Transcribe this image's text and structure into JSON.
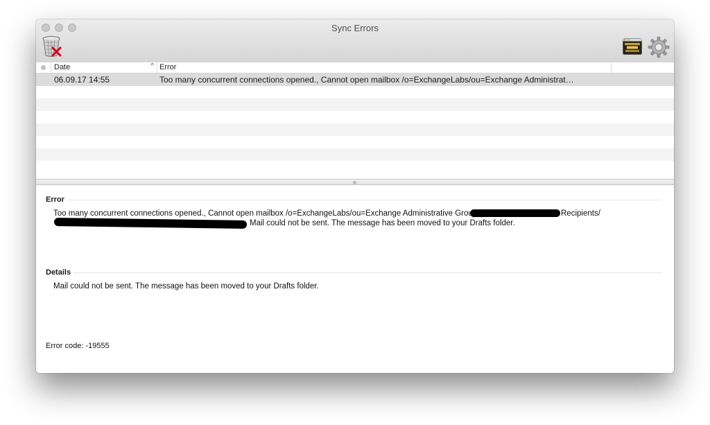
{
  "window": {
    "title": "Sync Errors"
  },
  "toolbar": {
    "trash_icon": "trash-can-with-red-x-icon",
    "app_icon": "application-thumbnail-icon",
    "gear_icon": "gear-icon"
  },
  "table": {
    "columns": {
      "date": "Date",
      "error": "Error"
    },
    "sort_indicator": "^",
    "rows": [
      {
        "date": "06.09.17 14:55",
        "error": "Too many concurrent connections opened., Cannot open mailbox /o=ExchangeLabs/ou=Exchange Administrat…"
      }
    ]
  },
  "detail": {
    "error_heading": "Error",
    "error_text_line1_a": "Too many concurrent connections opened., Cannot open mailbox /o=ExchangeLabs/ou=Exchange Administrative Group (",
    "error_text_line1_b": "Recipients/",
    "error_text_line2": "Mail could not be sent. The message has been moved to your Drafts folder.",
    "details_heading": "Details",
    "details_text": "Mail could not be sent. The message has been moved to your Drafts folder.",
    "error_code": "Error code: -19555"
  }
}
